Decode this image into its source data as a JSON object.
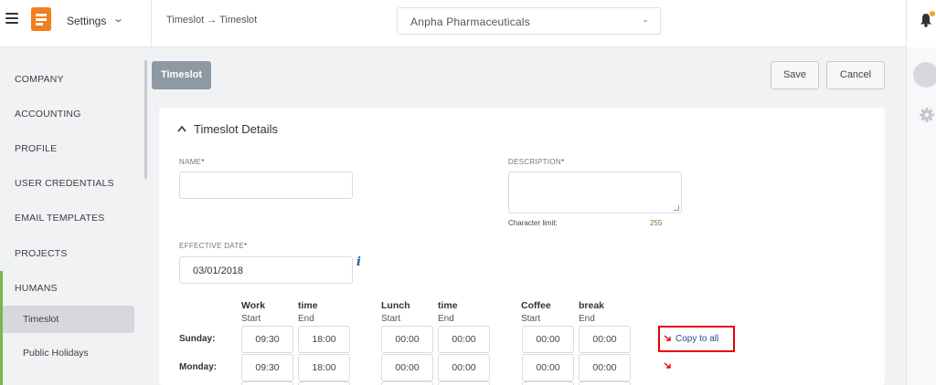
{
  "header": {
    "app_title": "Settings",
    "breadcrumb": "Timeslot → Timeslot",
    "company": "Anpha Pharmaceuticals"
  },
  "sidebar": {
    "items": [
      {
        "label": "COMPANY"
      },
      {
        "label": "ACCOUNTING"
      },
      {
        "label": "PROFILE"
      },
      {
        "label": "USER CREDENTIALS"
      },
      {
        "label": "EMAIL TEMPLATES"
      },
      {
        "label": "PROJECTS"
      },
      {
        "label": "HUMANS"
      }
    ],
    "subitems": [
      {
        "label": "Timeslot",
        "active": true
      },
      {
        "label": "Public Holidays"
      }
    ]
  },
  "toolbar": {
    "tab_label": "Timeslot",
    "save_label": "Save",
    "cancel_label": "Cancel"
  },
  "form": {
    "section_title": "Timeslot Details",
    "name_label": "NAME",
    "name_value": "",
    "description_label": "DESCRIPTION",
    "description_value": "",
    "char_limit_label": "Character limit:",
    "char_limit_value": "255",
    "effective_date_label": "EFFECTIVE DATE",
    "effective_date_value": "03/01/2018",
    "required_mark": "*"
  },
  "schedule": {
    "groups": [
      {
        "head_a": "Work",
        "head_b": "time",
        "sub_a": "Start",
        "sub_b": "End"
      },
      {
        "head_a": "Lunch",
        "head_b": "time",
        "sub_a": "Start",
        "sub_b": "End"
      },
      {
        "head_a": "Coffee",
        "head_b": "break",
        "sub_a": "Start",
        "sub_b": "End"
      }
    ],
    "rows": [
      {
        "day": "Sunday:",
        "times": [
          "09:30",
          "18:00",
          "00:00",
          "00:00",
          "00:00",
          "00:00"
        ]
      },
      {
        "day": "Monday:",
        "times": [
          "09:30",
          "18:00",
          "00:00",
          "00:00",
          "00:00",
          "00:00"
        ]
      }
    ],
    "copy_all_label": "Copy to all"
  },
  "colors": {
    "accent_green": "#77b84a",
    "highlight_red": "#e8000a",
    "logo_orange": "#f07f1e",
    "link_blue": "#1d4f8c"
  }
}
